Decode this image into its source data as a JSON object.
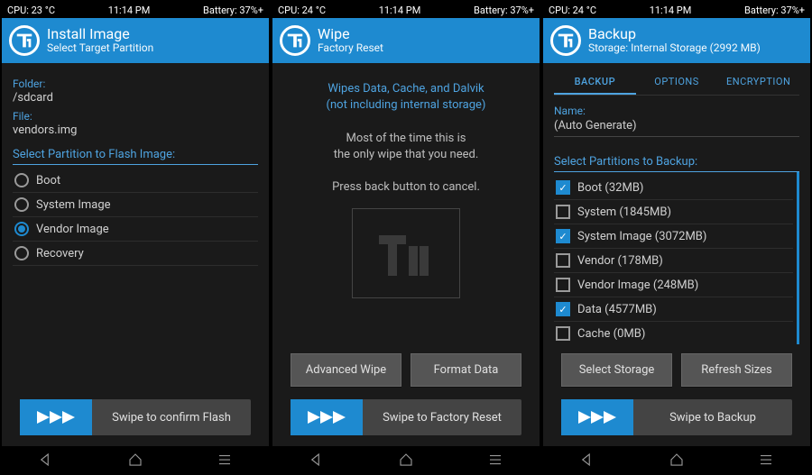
{
  "screens": [
    {
      "status": {
        "cpu": "CPU: 23 °C",
        "time": "11:14 PM",
        "battery": "Battery: 37%+"
      },
      "header": {
        "title": "Install Image",
        "subtitle": "Select Target Partition"
      },
      "folder_label": "Folder:",
      "folder_value": "/sdcard",
      "file_label": "File:",
      "file_value": "vendors.img",
      "partition_title": "Select Partition to Flash Image:",
      "partitions": [
        {
          "label": "Boot",
          "selected": false
        },
        {
          "label": "System Image",
          "selected": false
        },
        {
          "label": "Vendor Image",
          "selected": true
        },
        {
          "label": "Recovery",
          "selected": false
        }
      ],
      "swipe": "Swipe to confirm Flash"
    },
    {
      "status": {
        "cpu": "CPU: 24 °C",
        "time": "11:14 PM",
        "battery": "Battery: 37%+"
      },
      "header": {
        "title": "Wipe",
        "subtitle": "Factory Reset"
      },
      "blue_line1": "Wipes Data, Cache, and Dalvik",
      "blue_line2": "(not including internal storage)",
      "msg_line1": "Most of the time this is",
      "msg_line2": "the only wipe that you need.",
      "msg_line3": "Press back button to cancel.",
      "btn1": "Advanced Wipe",
      "btn2": "Format Data",
      "swipe": "Swipe to Factory Reset"
    },
    {
      "status": {
        "cpu": "CPU: 24 °C",
        "time": "11:14 PM",
        "battery": "Battery: 37%+"
      },
      "header": {
        "title": "Backup",
        "subtitle": "Storage: Internal Storage (2992 MB)"
      },
      "tabs": [
        "BACKUP",
        "OPTIONS",
        "ENCRYPTION"
      ],
      "active_tab": 0,
      "name_label": "Name:",
      "name_value": "(Auto Generate)",
      "partition_title": "Select Partitions to Backup:",
      "partitions": [
        {
          "label": "Boot (32MB)",
          "checked": true
        },
        {
          "label": "System (1845MB)",
          "checked": false
        },
        {
          "label": "System Image (3072MB)",
          "checked": true
        },
        {
          "label": "Vendor (178MB)",
          "checked": false
        },
        {
          "label": "Vendor Image (248MB)",
          "checked": false
        },
        {
          "label": "Data (4577MB)",
          "checked": true
        },
        {
          "label": "Cache (0MB)",
          "checked": false
        }
      ],
      "btn1": "Select Storage",
      "btn2": "Refresh Sizes",
      "swipe": "Swipe to Backup"
    }
  ]
}
